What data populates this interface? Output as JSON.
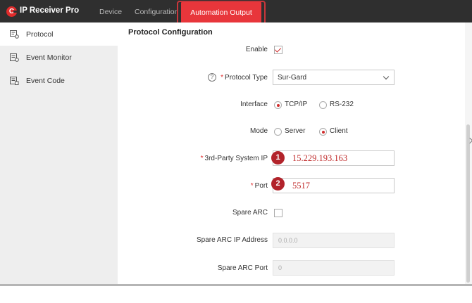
{
  "header": {
    "app_title": "IP Receiver Pro",
    "logo_letter": "C",
    "tabs": [
      {
        "label": "Device",
        "active": false
      },
      {
        "label": "Configuration",
        "active": false
      },
      {
        "label": "Automation Output",
        "active": true
      }
    ]
  },
  "sidebar": {
    "items": [
      {
        "label": "Protocol",
        "icon": "protocol-icon",
        "active": true
      },
      {
        "label": "Event Monitor",
        "icon": "event-monitor-icon",
        "active": false
      },
      {
        "label": "Event Code",
        "icon": "event-code-icon",
        "active": false
      }
    ]
  },
  "main": {
    "section_title": "Protocol Configuration",
    "enable": {
      "label": "Enable",
      "checked": true
    },
    "protocol_type": {
      "label": "Protocol Type",
      "value": "Sur-Gard",
      "required": true,
      "help_icon": "?"
    },
    "interface": {
      "label": "Interface",
      "options": [
        "TCP/IP",
        "RS-232"
      ],
      "selected": "TCP/IP"
    },
    "mode": {
      "label": "Mode",
      "options": [
        "Server",
        "Client"
      ],
      "selected": "Client"
    },
    "third_party_ip": {
      "label": "3rd-Party System IP",
      "value": "15.229.193.163",
      "required": true,
      "callout": "1"
    },
    "port": {
      "label": "Port",
      "value": "5517",
      "required": true,
      "callout": "2"
    },
    "spare_arc": {
      "label": "Spare ARC",
      "checked": false
    },
    "spare_arc_ip": {
      "label": "Spare ARC IP Address",
      "placeholder": "0.0.0.0"
    },
    "spare_arc_port": {
      "label": "Spare ARC Port",
      "placeholder": "0"
    }
  },
  "colors": {
    "accent": "#e8363b",
    "topbar": "#2f2f2f",
    "sidebar_bg": "#eeeeee",
    "callout": "#b2232b"
  },
  "required_marker": "*"
}
